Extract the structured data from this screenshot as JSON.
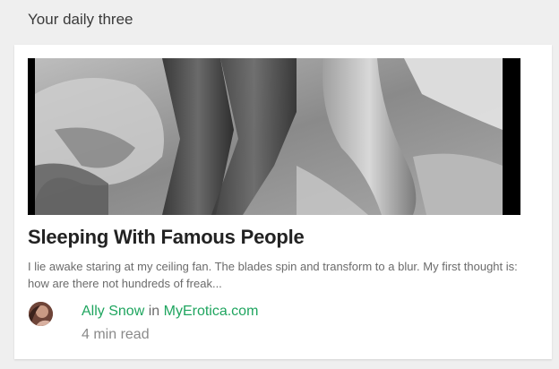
{
  "section": {
    "title": "Your daily three"
  },
  "post": {
    "image_icon": "photo-thumbnail",
    "title": "Sleeping With Famous People",
    "excerpt": "I lie awake staring at my ceiling fan. The blades spin and transform to a blur. My first thought is: how are there not hundreds of freak...",
    "author": "Ally Snow",
    "in_word": "in",
    "publication": "MyErotica.com",
    "read_time": "4 min read"
  },
  "colors": {
    "link_green": "#1fa55f",
    "background": "#efefef",
    "card": "#ffffff"
  }
}
